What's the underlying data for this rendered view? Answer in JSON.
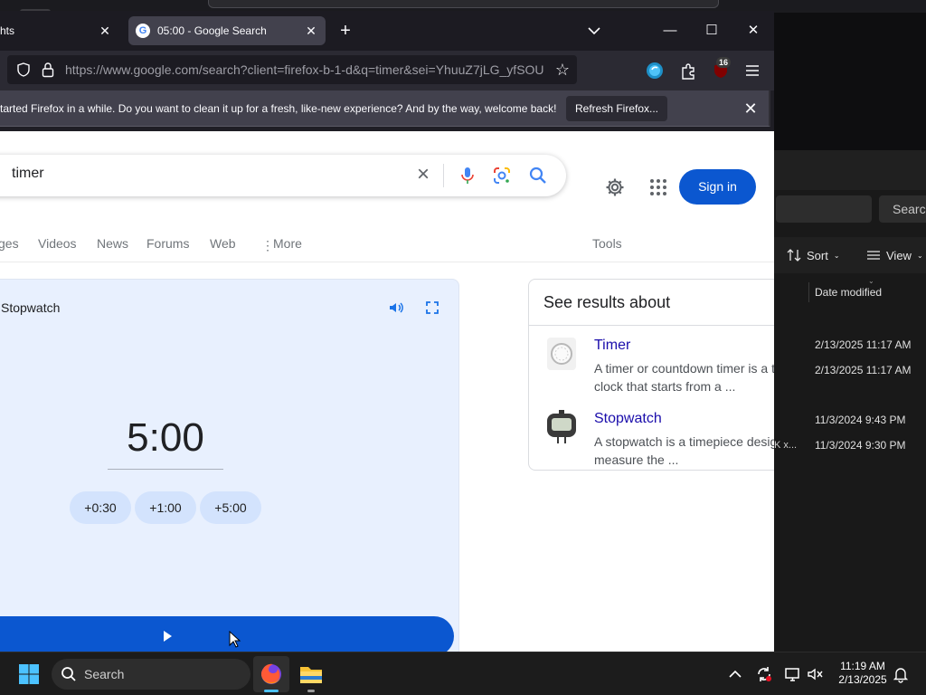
{
  "firefox": {
    "tabs": [
      {
        "label": "hts"
      },
      {
        "label": "05:00 - Google Search"
      }
    ],
    "url": "https://www.google.com/search?client=firefox-b-1-d&q=timer&sei=YhuuZ7jLG_yfSOU",
    "extension_badge": "16",
    "notification": {
      "text": "tarted Firefox in a while. Do you want to clean it up for a fresh, like-new experience? And by the way, welcome back!",
      "button_label": "Refresh Firefox..."
    }
  },
  "google": {
    "search_query": "timer",
    "sign_in_label": "Sign in",
    "filters": [
      "ges",
      "Videos",
      "News",
      "Forums",
      "Web",
      "More"
    ],
    "tools_label": "Tools",
    "timer_widget": {
      "tab_label": "Stopwatch",
      "time": "5:00",
      "increments": [
        "+0:30",
        "+1:00",
        "+5:00"
      ]
    },
    "see_results_about": {
      "heading": "See results about",
      "items": [
        {
          "title": "Timer",
          "desc_line1": "A timer or countdown timer is a t",
          "desc_line2": "clock that starts from a ..."
        },
        {
          "title": "Stopwatch",
          "desc_line1": "A stopwatch is a timepiece desig",
          "desc_line2": "measure the ..."
        }
      ]
    }
  },
  "explorer": {
    "search_label": "Search",
    "sort_label": "Sort",
    "view_label": "View",
    "column_header": "Date modified",
    "rows": [
      "2/13/2025 11:17 AM",
      "2/13/2025 11:17 AM",
      "11/3/2024 9:43 PM",
      "11/3/2024 9:30 PM"
    ],
    "row_fragment": "K x..."
  },
  "taskbar": {
    "search_label": "Search",
    "time": "11:19 AM",
    "date": "2/13/2025"
  },
  "colors": {
    "google_blue": "#0b57d0",
    "timer_card_bg": "#e8f0fe",
    "firefox_chrome": "#2b2a33",
    "taskbar_bg": "#1c1c1c"
  }
}
